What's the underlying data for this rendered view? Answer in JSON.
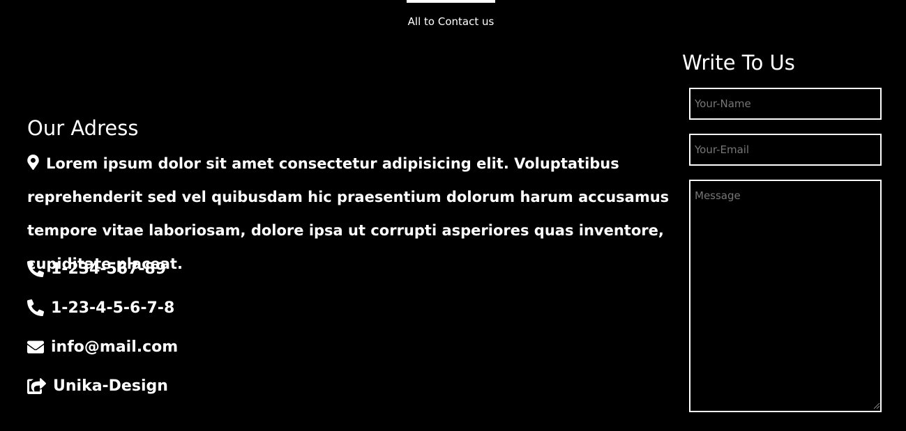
{
  "header": {
    "subtitle": "All to Contact us"
  },
  "address": {
    "title": "Our Adress",
    "text": "Lorem ipsum dolor sit amet consectetur adipisicing elit. Voluptatibus reprehenderit sed vel quibusdam hic praesentium dolorum harum accusamus tempore vitae laboriosam, dolore ipsa ut corrupti asperiores quas inventore, cupiditate placeat.",
    "icon": "map-marker-icon"
  },
  "contacts": [
    {
      "icon": "phone-icon",
      "text": "1-234-567-89"
    },
    {
      "icon": "phone-icon",
      "text": "1-23-4-5-6-7-8"
    },
    {
      "icon": "envelope-icon",
      "text": "info@mail.com"
    },
    {
      "icon": "share-square-icon",
      "text": "Unika-Design"
    }
  ],
  "form": {
    "title": "Write To Us",
    "name_placeholder": "Your-Name",
    "email_placeholder": "Your-Email",
    "message_placeholder": "Message"
  },
  "colors": {
    "background": "#000000",
    "text": "#ffffff",
    "placeholder": "#777777"
  }
}
